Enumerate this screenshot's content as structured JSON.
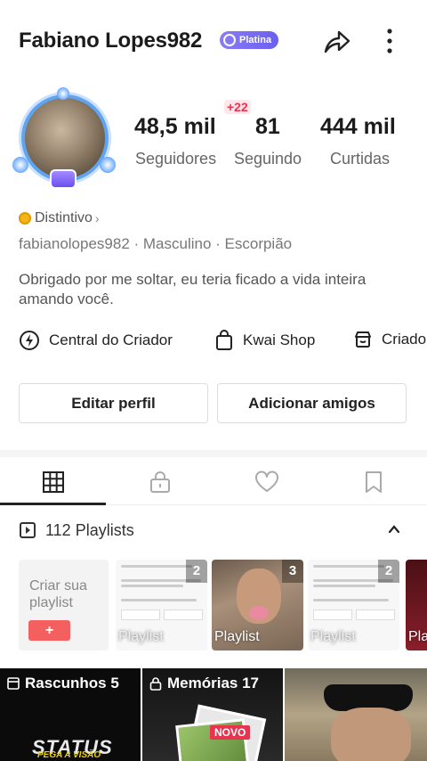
{
  "profile": {
    "username": "Fabiano Lopes982",
    "badge_label": "Platina",
    "handle_line": "fabianolopes982 · Masculino · Escorpião",
    "distintivo": "Distintivo",
    "bio": "Obrigado por me soltar, eu teria ficado a vida inteira amando você."
  },
  "stats": {
    "followers_value": "48,5 mil",
    "followers_label": "Seguidores",
    "following_value": "81",
    "following_label": "Seguindo",
    "following_badge": "+22",
    "likes_value": "444 mil",
    "likes_label": "Curtidas"
  },
  "links": [
    {
      "label": "Central do Criador",
      "icon": "lightning-icon"
    },
    {
      "label": "Kwai Shop",
      "icon": "shopping-bag-icon"
    },
    {
      "label": "Criado",
      "icon": "store-icon"
    }
  ],
  "buttons": {
    "edit_profile": "Editar perfil",
    "add_friends": "Adicionar amigos"
  },
  "tabs": [
    {
      "name": "grid-icon",
      "active": true
    },
    {
      "name": "lock-icon",
      "active": false
    },
    {
      "name": "heart-icon",
      "active": false
    },
    {
      "name": "bookmark-icon",
      "active": false
    }
  ],
  "playlists": {
    "header": "112 Playlists",
    "create_label": "Criar sua playlist",
    "create_button": "+",
    "items": [
      {
        "label": "Playlist",
        "count": "2"
      },
      {
        "label": "Playlist",
        "count": "3"
      },
      {
        "label": "Playlist",
        "count": "2"
      },
      {
        "label": "Pla",
        "count": ""
      }
    ]
  },
  "grid": {
    "drafts_label": "Rascunhos 5",
    "memories_label": "Memórias 17",
    "novo_badge": "NOVO",
    "status_text": "STATUS",
    "status_sub": "PEGA A VISÃO"
  },
  "colors": {
    "accent_red": "#e8344e",
    "badge_purple": "#7a6ef4",
    "create_button": "#f4605f"
  }
}
